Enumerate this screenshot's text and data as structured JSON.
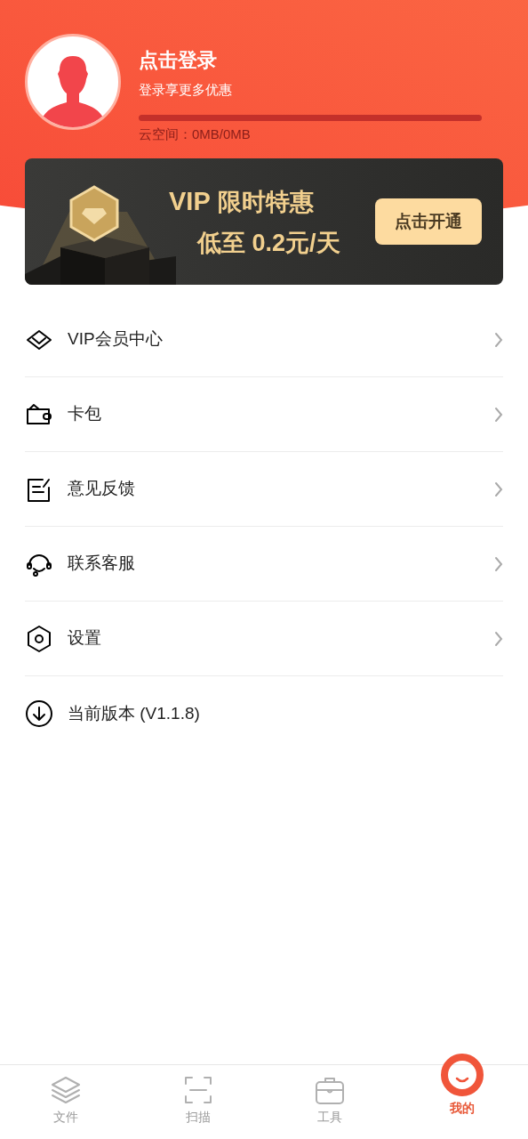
{
  "profile": {
    "title": "点击登录",
    "subtitle": "登录享更多优惠",
    "storage": {
      "label": "云空间：0MB/0MB"
    }
  },
  "vip_banner": {
    "headline_prefix": "VIP",
    "headline": "限时特惠",
    "price": "低至 0.2元/天",
    "button": "点击开通"
  },
  "menu": [
    {
      "kind": "vip",
      "label": "VIP会员中心",
      "chevron": true
    },
    {
      "kind": "wallet",
      "label": "卡包",
      "chevron": true
    },
    {
      "kind": "feedback",
      "label": "意见反馈",
      "chevron": true
    },
    {
      "kind": "support",
      "label": "联系客服",
      "chevron": true
    },
    {
      "kind": "settings",
      "label": "设置",
      "chevron": true
    },
    {
      "kind": "version",
      "label": "当前版本 (V1.1.8)",
      "chevron": false
    }
  ],
  "tabs": [
    {
      "kind": "files",
      "label": "文件",
      "selected": false
    },
    {
      "kind": "scan",
      "label": "扫描",
      "selected": false
    },
    {
      "kind": "tools",
      "label": "工具",
      "selected": false
    },
    {
      "kind": "me",
      "label": "我的",
      "selected": true
    }
  ]
}
